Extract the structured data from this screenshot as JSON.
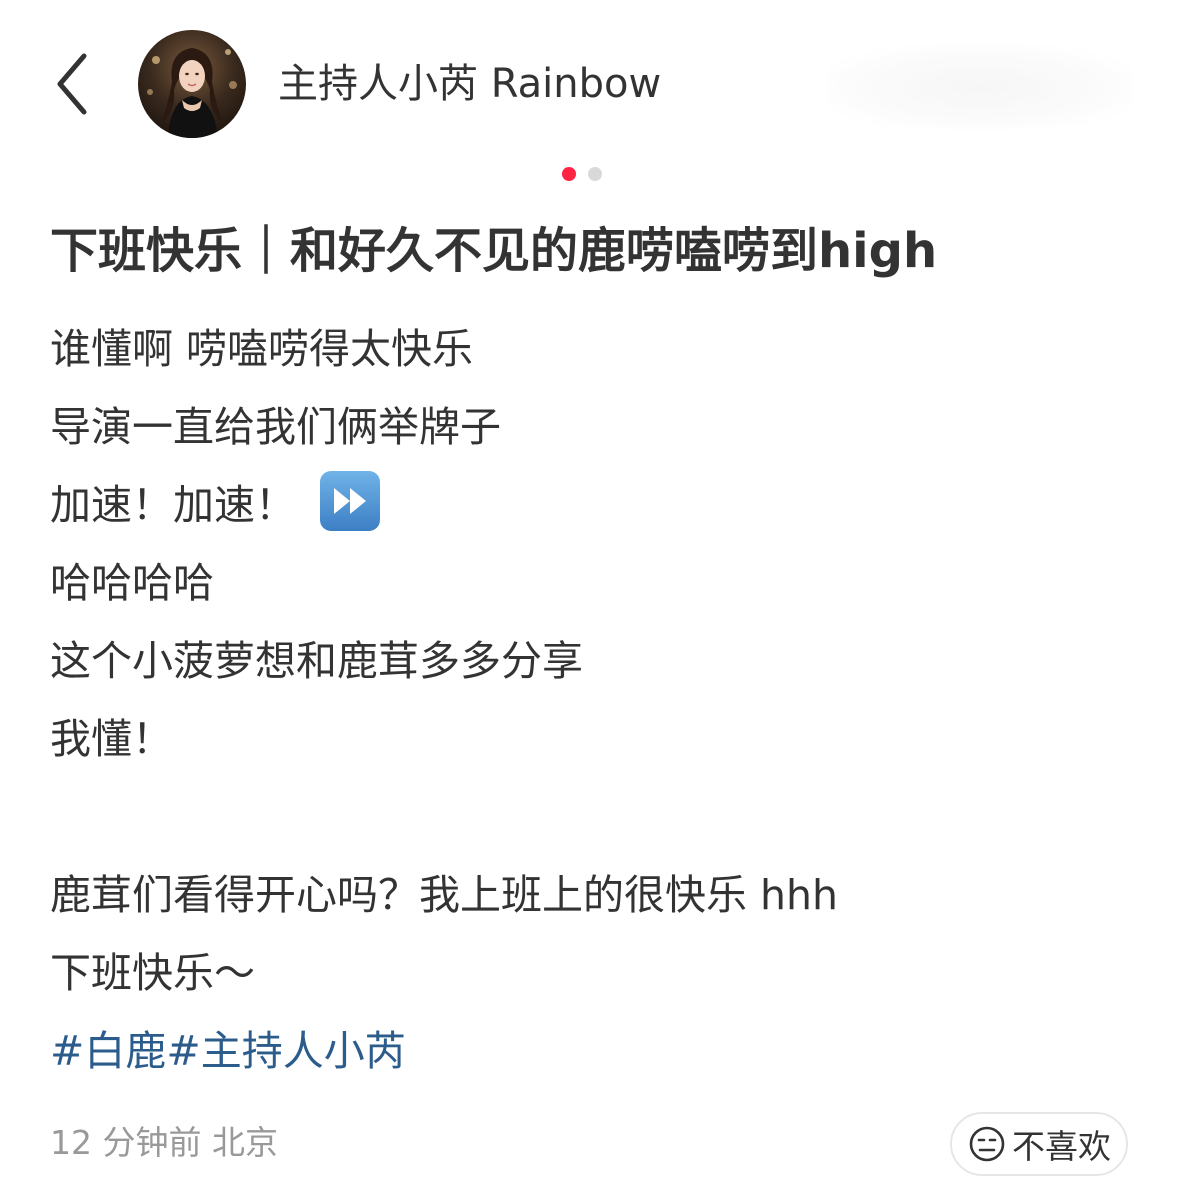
{
  "header": {
    "author_name": "主持人小芮 Rainbow",
    "back_icon": "chevron-left-icon"
  },
  "carousel": {
    "total": 2,
    "active_index": 0,
    "active_color": "#ff2442",
    "inactive_color": "#d9d9d9"
  },
  "post": {
    "title": "下班快乐｜和好久不见的鹿唠嗑唠到high",
    "lines": [
      "谁懂啊 唠嗑唠得太快乐",
      "导演一直给我们俩举牌子",
      "加速！加速！",
      "哈哈哈哈",
      "这个小菠萝想和鹿茸多多分享",
      "我懂！",
      "",
      "鹿茸们看得开心吗？我上班上的很快乐 hhh",
      "下班快乐～"
    ],
    "emoji": "fast-forward-icon",
    "tags": [
      "#白鹿",
      "#主持人小芮"
    ]
  },
  "meta": {
    "time_location": "12 分钟前 北京"
  },
  "actions": {
    "dislike_label": "不喜欢",
    "dislike_icon": "meh-face-icon"
  },
  "colors": {
    "text": "#333333",
    "muted": "#999999",
    "tag": "#2b5c8c",
    "accent": "#ff2442"
  }
}
